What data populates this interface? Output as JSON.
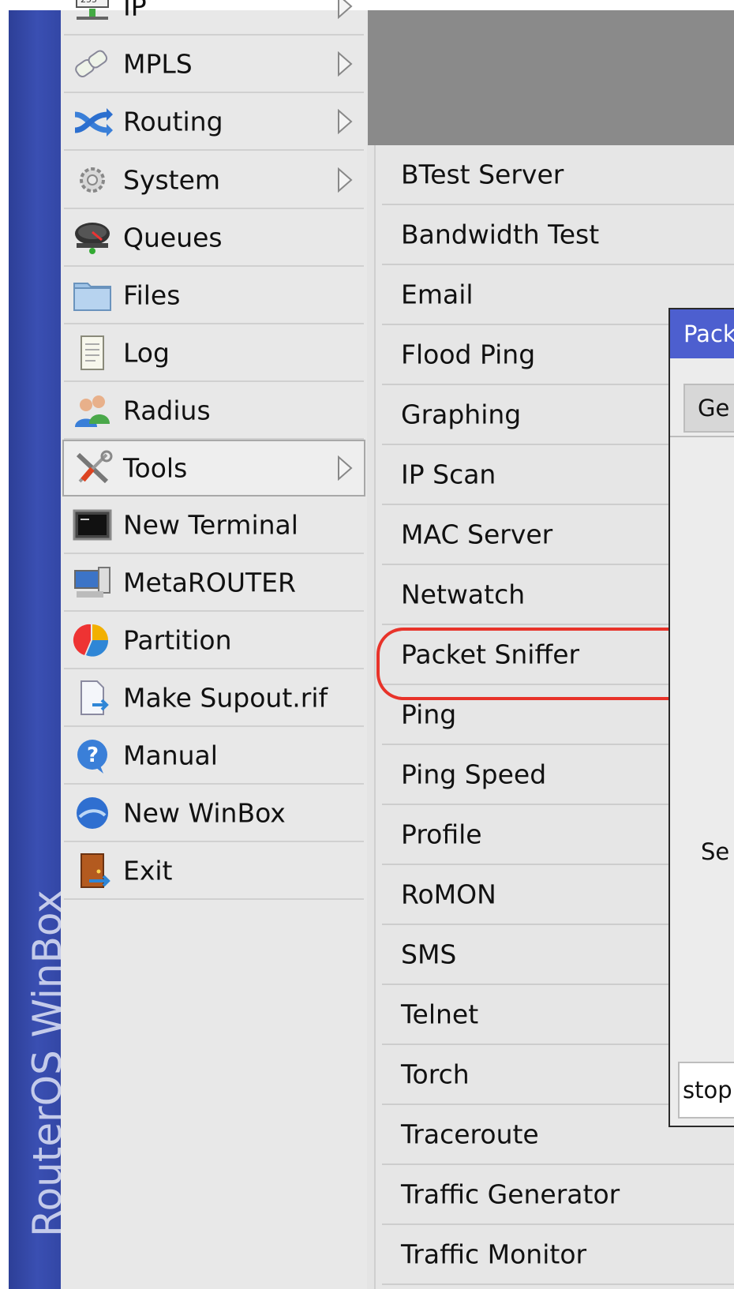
{
  "brand": {
    "text": "RouterOS WinBox"
  },
  "main_menu": {
    "items": [
      {
        "label": "IP",
        "icon": "ip-icon",
        "submenu": true
      },
      {
        "label": "MPLS",
        "icon": "mpls-icon",
        "submenu": true
      },
      {
        "label": "Routing",
        "icon": "routing-icon",
        "submenu": true
      },
      {
        "label": "System",
        "icon": "system-gear-icon",
        "submenu": true
      },
      {
        "label": "Queues",
        "icon": "queues-icon",
        "submenu": false
      },
      {
        "label": "Files",
        "icon": "folder-icon",
        "submenu": false
      },
      {
        "label": "Log",
        "icon": "log-icon",
        "submenu": false
      },
      {
        "label": "Radius",
        "icon": "radius-users-icon",
        "submenu": false
      },
      {
        "label": "Tools",
        "icon": "tools-icon",
        "submenu": true,
        "selected": true
      },
      {
        "label": "New Terminal",
        "icon": "terminal-icon",
        "submenu": false
      },
      {
        "label": "MetaROUTER",
        "icon": "metarouter-icon",
        "submenu": false
      },
      {
        "label": "Partition",
        "icon": "partition-icon",
        "submenu": false
      },
      {
        "label": "Make Supout.rif",
        "icon": "supout-file-icon",
        "submenu": false
      },
      {
        "label": "Manual",
        "icon": "help-icon",
        "submenu": false
      },
      {
        "label": "New WinBox",
        "icon": "winbox-icon",
        "submenu": false
      },
      {
        "label": "Exit",
        "icon": "exit-door-icon",
        "submenu": false
      }
    ]
  },
  "tools_submenu": {
    "items": [
      "BTest Server",
      "Bandwidth Test",
      "Email",
      "Flood Ping",
      "Graphing",
      "IP Scan",
      "MAC Server",
      "Netwatch",
      "Packet Sniffer",
      "Ping",
      "Ping Speed",
      "Profile",
      "RoMON",
      "SMS",
      "Telnet",
      "Torch",
      "Traceroute",
      "Traffic Generator",
      "Traffic Monitor"
    ],
    "highlighted": "Packet Sniffer",
    "highlight_color": "#e8332a"
  },
  "packet_sniffer_window": {
    "title": "Pack",
    "tab_general": "Ge",
    "field_label": "Se",
    "status": "stop"
  },
  "colors": {
    "brand_bar": "#3a4fb2",
    "window_title": "#4d5fcf",
    "menu_bg": "#e8e8e8"
  }
}
